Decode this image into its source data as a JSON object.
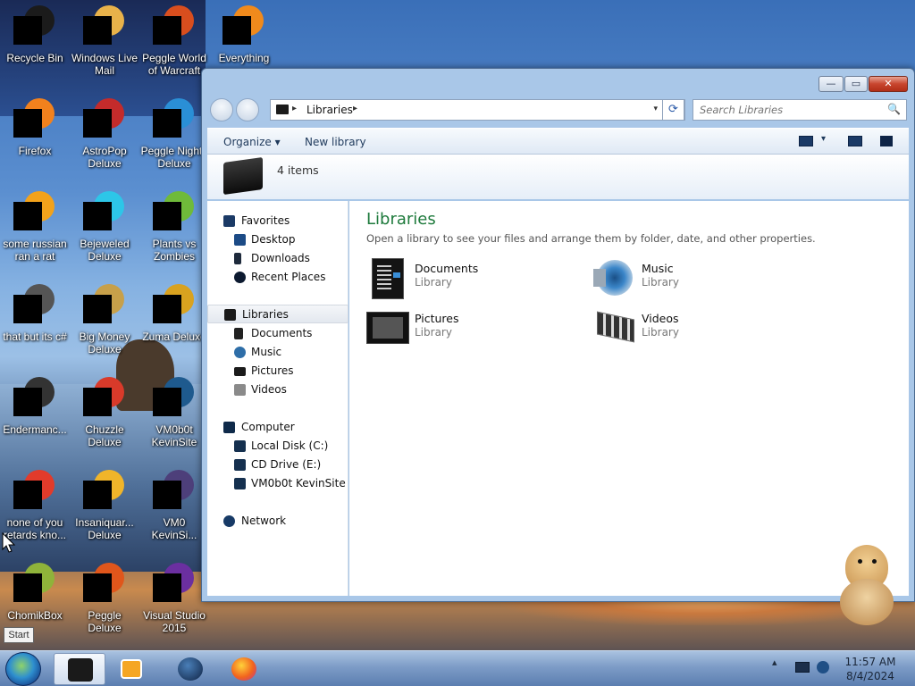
{
  "desktop": {
    "icons": [
      {
        "label": "Recycle Bin",
        "art": "#1b1b1b"
      },
      {
        "label": "Windows Live Mail",
        "art": "#e8b24a"
      },
      {
        "label": "Peggle World of Warcraft",
        "art": "#d94e1e"
      },
      {
        "label": "Everything",
        "art": "#f08a1c"
      },
      {
        "label": "Firefox",
        "art": "#f2811d"
      },
      {
        "label": "AstroPop Deluxe",
        "art": "#c42b2b"
      },
      {
        "label": "Peggle Nights Deluxe",
        "art": "#2a8fd6"
      },
      {
        "label": "some russian ran a rat",
        "art": "#f2a21b"
      },
      {
        "label": "Bejeweled Deluxe",
        "art": "#2dc6e8"
      },
      {
        "label": "Plants vs Zombies",
        "art": "#6fba3a"
      },
      {
        "label": "that but its c#",
        "art": "#555555"
      },
      {
        "label": "Big Money Deluxe",
        "art": "#c7a04a"
      },
      {
        "label": "Zuma Deluxe",
        "art": "#d9a21f"
      },
      {
        "label": "Endermanc...",
        "art": "#333333"
      },
      {
        "label": "Chuzzle Deluxe",
        "art": "#d93a2a"
      },
      {
        "label": "VM0b0t KevinSite",
        "art": "#1e5a8e"
      },
      {
        "label": "none of you retards kno...",
        "art": "#e23b2b"
      },
      {
        "label": "Insaniquar... Deluxe",
        "art": "#f0b52a"
      },
      {
        "label": "VM0 KevinSi...",
        "art": "#4d3f7a"
      },
      {
        "label": "ChomikBox",
        "art": "#8fb33a"
      },
      {
        "label": "Peggle Deluxe",
        "art": "#e0561b"
      },
      {
        "label": "Visual Studio 2015",
        "art": "#6b2fa0"
      }
    ]
  },
  "window": {
    "min_glyph": "—",
    "max_glyph": "▭",
    "close_glyph": "✕",
    "address": {
      "crumb": "Libraries",
      "sep1": "▸",
      "sep2": "▸",
      "dropdown": "▾"
    },
    "refresh_glyph": "⟳",
    "search": {
      "placeholder": "Search Libraries",
      "icon": "🔍"
    },
    "toolbar": {
      "organize": "Organize ▾",
      "new_library": "New library",
      "view_dd": "▾"
    },
    "details": {
      "count": "4 items"
    },
    "nav": {
      "favorites": "Favorites",
      "desktop": "Desktop",
      "downloads": "Downloads",
      "recent": "Recent Places",
      "libraries": "Libraries",
      "documents": "Documents",
      "music": "Music",
      "pictures": "Pictures",
      "videos": "Videos",
      "computer": "Computer",
      "local_disk": "Local Disk (C:)",
      "cd_drive": "CD Drive (E:)",
      "vm0b0t": "VM0b0t KevinSite",
      "network": "Network"
    },
    "content": {
      "title": "Libraries",
      "subtitle": "Open a library to see your files and arrange them by folder, date, and other properties.",
      "items": [
        {
          "name": "Documents",
          "type": "Library"
        },
        {
          "name": "Music",
          "type": "Library"
        },
        {
          "name": "Pictures",
          "type": "Library"
        },
        {
          "name": "Videos",
          "type": "Library"
        }
      ]
    }
  },
  "taskbar": {
    "start_tooltip": "Start",
    "tray_up": "▴",
    "time": "11:57 AM",
    "date": "8/4/2024"
  },
  "colors": {
    "content_title": "#1e7a3c",
    "close": "#c8452e"
  }
}
